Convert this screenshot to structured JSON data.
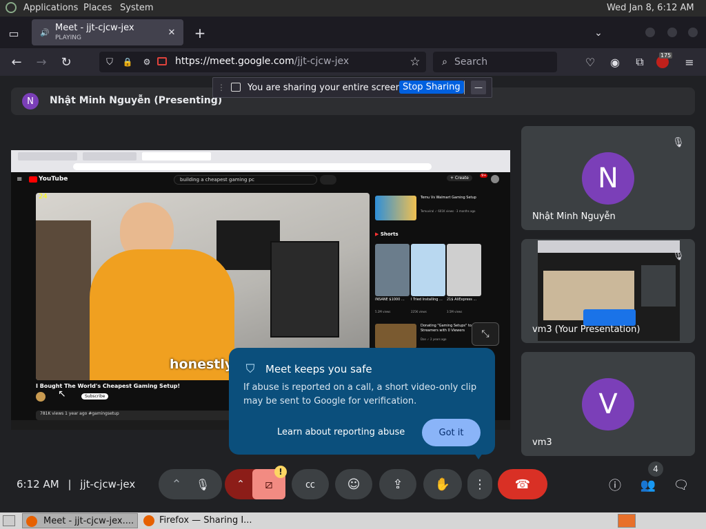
{
  "gnome": {
    "menu_apps": "Applications",
    "menu_places": "Places",
    "menu_system": "System",
    "clock": "Wed Jan  8,  6:12 AM"
  },
  "tab": {
    "title": "Meet - jjt-cjcw-jex",
    "subtitle": "PLAYING"
  },
  "nav": {
    "url_host": "https://meet.google.com",
    "url_path": "/jjt-cjcw-jex",
    "search_placeholder": "Search",
    "badge": "175"
  },
  "banner": {
    "text": "You are sharing your entire screen.",
    "stop_label": "Stop Sharing",
    "min_label": "—"
  },
  "presenter": {
    "initial": "N",
    "label": "Nhật Minh Nguyễn (Presenting)"
  },
  "shared": {
    "logo": "YouTube",
    "search": "building a cheapest gaming pc",
    "create": "+ Create",
    "notif_count": "9+",
    "caption": "honestly",
    "video_title": "I Bought The World's Cheapest Gaming Setup!",
    "subscribe": "Subscribe",
    "meta": "781K views  1 year ago  #gamingsetup",
    "counter": "24",
    "side1_title": "Temu Vs Walmart Gaming Setup",
    "side1_meta": "Temuviral ✓  601K views · 3 months ago",
    "shorts_label": "Shorts",
    "shorts": [
      {
        "title": "INSANE $1000 ...",
        "views": "5.2M views"
      },
      {
        "title": "I Tried Installing ...",
        "views": "225K views"
      },
      {
        "title": "21$ AliExpress ...",
        "views": "3.5M views"
      }
    ],
    "side2_title": "Donating \"Gaming Setups\" to Streamers with 0 Viewers",
    "side2_meta": "Dan ✓  2 years ago"
  },
  "tiles": [
    {
      "initial": "N",
      "name": "Nhật Minh Nguyễn",
      "color": "#7b3fb8"
    },
    {
      "name": "vm3 (Your Presentation)"
    },
    {
      "initial": "V",
      "name": "vm3",
      "color": "#7b3fb8"
    }
  ],
  "popup": {
    "title": "Meet keeps you safe",
    "body": "If abuse is reported on a call, a short video-only clip may be sent to Google for verification.",
    "link": "Learn about reporting abuse",
    "button": "Got it"
  },
  "bottom": {
    "time": "6:12 AM",
    "separator": "|",
    "meeting_code": "jjt-cjcw-jex",
    "people_count": "4",
    "alert": "!"
  },
  "taskbar": {
    "item1": "Meet - jjt-cjcw-jex....",
    "item2": "Firefox — Sharing I..."
  },
  "colors": {
    "avatar": "#7b3fb8",
    "end_call": "#d93025",
    "camera_off": "#f28b82",
    "popup": "#0b4f7c",
    "popup_button": "#8ab4f8",
    "mic_off_bg": "#8c1d18"
  }
}
